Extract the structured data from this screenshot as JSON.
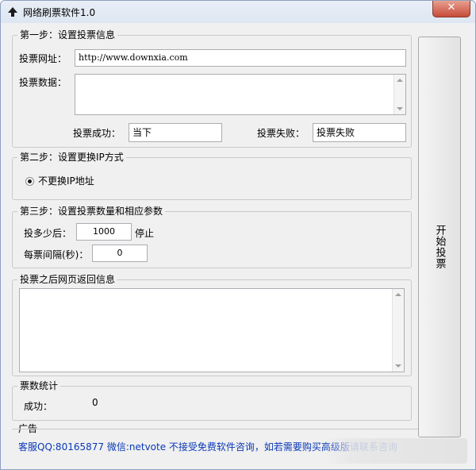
{
  "window": {
    "title": "网络刷票软件1.0",
    "close_symbol": "✕"
  },
  "step1": {
    "legend": "第一步：设置投票信息",
    "url_label": "投票网址：",
    "url_value": "http://www.downxia.com",
    "data_label": "投票数据：",
    "success_label": "投票成功：",
    "success_value": "当下",
    "fail_label": "投票失败：",
    "fail_value": "投票失败"
  },
  "step2": {
    "legend": "第二步：设置更换IP方式",
    "option_label": "不更换IP地址"
  },
  "step3": {
    "legend": "第三步：设置投票数量和相应参数",
    "count_label": "投多少后：",
    "count_value": "1000",
    "count_suffix": "停止",
    "interval_label": "每票间隔(秒)：",
    "interval_value": "0"
  },
  "response": {
    "legend": "投票之后网页返回信息"
  },
  "stats": {
    "legend": "票数统计",
    "success_label": "成功：",
    "success_value": "0"
  },
  "ad": {
    "legend": "广告",
    "text": "客服QQ:80165877   微信:netvote 不接受免费软件咨询，如若需要购买高级版请联系咨询"
  },
  "start_button": {
    "label": "开始投票"
  },
  "colors": {
    "link": "#0a39b8",
    "close": "#c74b3a"
  }
}
